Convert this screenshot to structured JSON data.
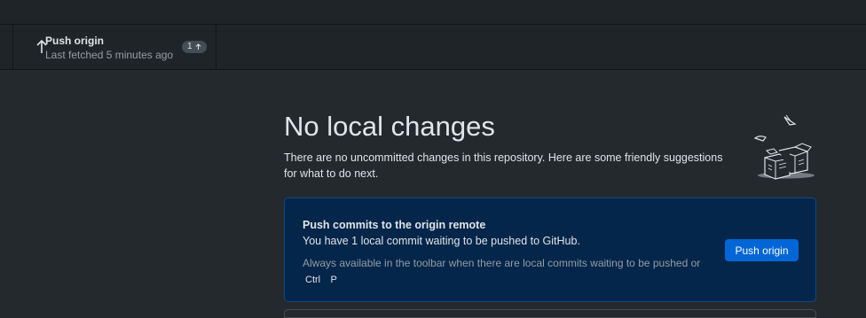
{
  "toolbar": {
    "push": {
      "title": "Push origin",
      "subtitle": "Last fetched 5 minutes ago",
      "ahead_count": "1"
    }
  },
  "main": {
    "heading": "No local changes",
    "description": "There are no uncommitted changes in this repository. Here are some friendly suggestions for what to do next.",
    "card": {
      "title": "Push commits to the origin remote",
      "description": "You have 1 local commit waiting to be pushed to GitHub.",
      "hint": "Always available in the toolbar when there are local commits waiting to be pushed or",
      "shortcut_keys": [
        "Ctrl",
        "P"
      ],
      "button_label": "Push origin"
    }
  },
  "colors": {
    "background": "#24292e",
    "toolbar": "#1f2428",
    "card_background": "#04264a",
    "card_border": "#0b4a8b",
    "primary_button": "#0366d6"
  },
  "icons": {
    "push_icon": "arrow-up-icon",
    "badge_icon": "arrow-up-small-icon",
    "illustration": "empty-boxes-illustration"
  }
}
